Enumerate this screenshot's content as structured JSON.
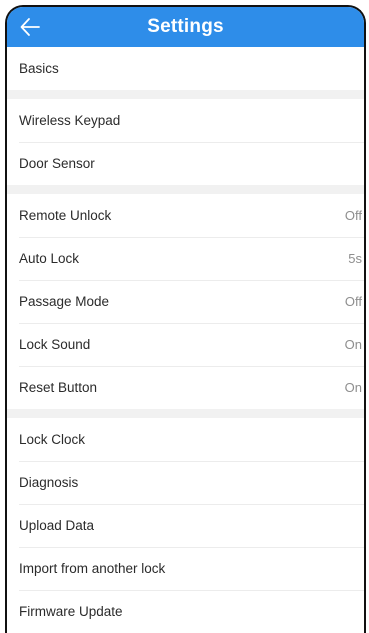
{
  "header": {
    "title": "Settings",
    "back_icon": "arrow-left-icon"
  },
  "sections": [
    {
      "rows": [
        {
          "label": "Basics",
          "value": ""
        }
      ]
    },
    {
      "rows": [
        {
          "label": "Wireless Keypad",
          "value": ""
        },
        {
          "label": "Door Sensor",
          "value": ""
        }
      ]
    },
    {
      "rows": [
        {
          "label": "Remote Unlock",
          "value": "Off"
        },
        {
          "label": "Auto Lock",
          "value": "5s"
        },
        {
          "label": "Passage Mode",
          "value": "Off"
        },
        {
          "label": "Lock Sound",
          "value": "On"
        },
        {
          "label": "Reset Button",
          "value": "On"
        }
      ]
    },
    {
      "rows": [
        {
          "label": "Lock Clock",
          "value": ""
        },
        {
          "label": "Diagnosis",
          "value": ""
        },
        {
          "label": "Upload Data",
          "value": ""
        },
        {
          "label": "Import from another lock",
          "value": ""
        },
        {
          "label": "Firmware Update",
          "value": ""
        }
      ]
    }
  ],
  "colors": {
    "header_bg": "#2e8de9",
    "section_gap": "#f1f1f1"
  }
}
